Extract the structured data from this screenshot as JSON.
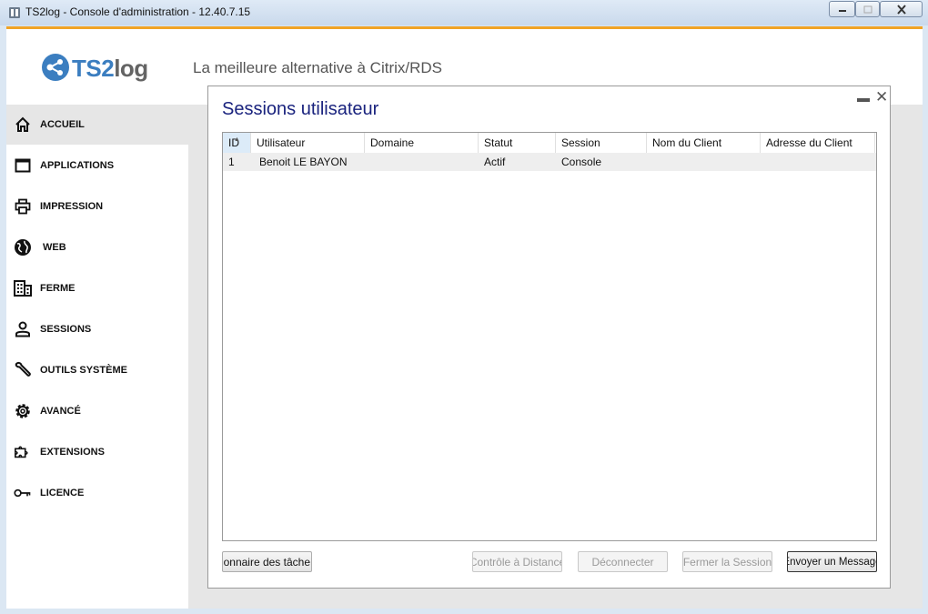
{
  "window": {
    "title": "TS2log - Console d'administration - 12.40.7.15"
  },
  "header": {
    "logo_ts": "TS2",
    "logo_log": "log",
    "tagline": "La meilleure alternative à Citrix/RDS"
  },
  "sidebar": {
    "items": [
      {
        "label": "ACCUEIL",
        "icon": "home-icon",
        "active": true
      },
      {
        "label": "APPLICATIONS",
        "icon": "window-icon"
      },
      {
        "label": "IMPRESSION",
        "icon": "printer-icon"
      },
      {
        "label": "WEB",
        "icon": "globe-icon"
      },
      {
        "label": "FERME",
        "icon": "building-icon"
      },
      {
        "label": "SESSIONS",
        "icon": "user-icon"
      },
      {
        "label": "OUTILS SYSTÈME",
        "icon": "wrench-icon"
      },
      {
        "label": "AVANCÉ",
        "icon": "gear-icon"
      },
      {
        "label": "EXTENSIONS",
        "icon": "puzzle-icon"
      },
      {
        "label": "LICENCE",
        "icon": "key-icon"
      }
    ]
  },
  "dialog": {
    "title": "Sessions utilisateur",
    "columns": [
      "ID",
      "Utilisateur",
      "Domaine",
      "Statut",
      "Session",
      "Nom du Client",
      "Adresse du Client"
    ],
    "rows": [
      [
        "1",
        "Benoit LE BAYON",
        "",
        "Actif",
        "Console",
        "",
        ""
      ]
    ],
    "buttons": {
      "task_manager": "stionnaire des tâche",
      "remote_control": "Contrôle à Distance",
      "disconnect": "Déconnecter",
      "close_session": "Fermer la Session",
      "send_message": "Envoyer un Message"
    }
  },
  "colors": {
    "accent": "#f0a326",
    "brand_blue": "#3b7ec0",
    "title_blue": "#1a237e"
  }
}
